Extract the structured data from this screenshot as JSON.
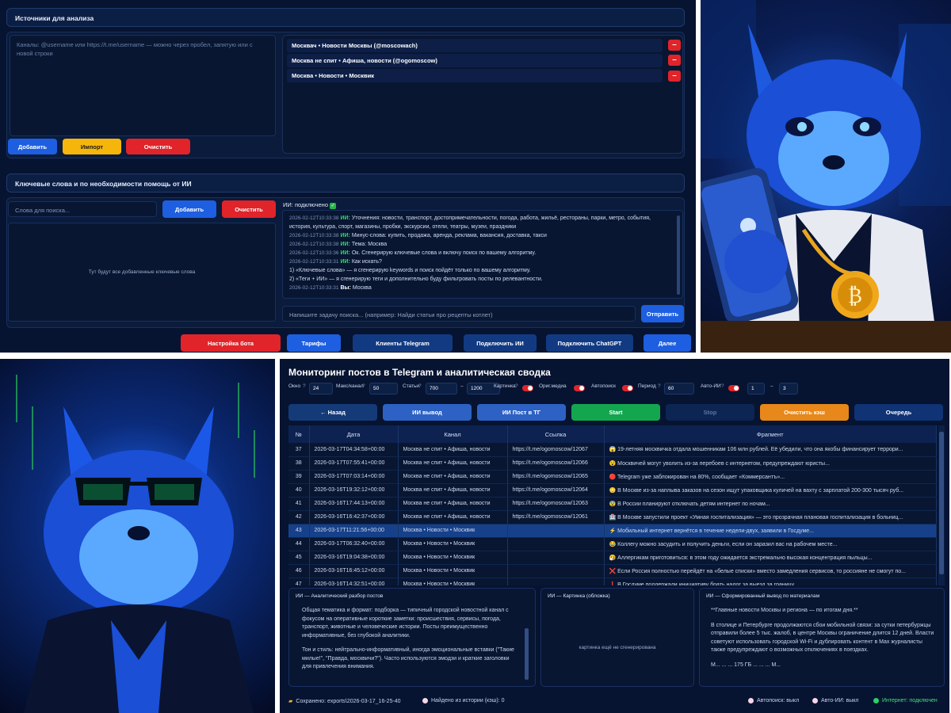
{
  "top": {
    "sources_title": "Источники для анализа",
    "sources_placeholder": "Каналы: @username или https://t.me/username — можно через пробел, запятую или с новой строки",
    "channels": [
      "Москвач • Новости Москвы  (@moscowach)",
      "Москва не спит • Афиша, новости  (@ogomoscow)",
      "Москва • Новости • Москвик"
    ],
    "remove_label": "–",
    "add_label": "Добавить",
    "import_label": "Импорт",
    "clear_label": "Очистить",
    "keywords_title": "Ключевые слова и по необходимости помощь от ИИ",
    "search_placeholder": "Слова для поиска...",
    "kw_add_label": "Добавить",
    "kw_clear_label": "Очистить",
    "ai_status": "ИИ: подключено",
    "kw_empty": "Тут будут все добавленные ключевые слова",
    "chat_log": [
      {
        "ts": "2026-02-12T10:33:38",
        "who": "ИИ:",
        "text": "Уточнения: новости, транспорт, достопримечательности, погода, работа, жильё, рестораны, парки, метро, события,"
      },
      {
        "ts": "",
        "who": "",
        "text": "история, культура, спорт, магазины, пробки, экскурсии, отели, театры, музеи, праздники"
      },
      {
        "ts": "2026-02-12T10:33:38",
        "who": "ИИ:",
        "text": "Минус-слова: купить, продажа, аренда, реклама, вакансия, доставка, такси"
      },
      {
        "ts": "2026-02-12T10:33:38",
        "who": "ИИ:",
        "text": "Тема: Москва"
      },
      {
        "ts": "2026-02-12T10:33:36",
        "who": "ИИ:",
        "text": "Ок. Сгенерирую ключевые слова и включу поиск по вашему алгоритму."
      },
      {
        "ts": "2026-02-12T10:33:31",
        "who": "ИИ:",
        "text": "Как искать?"
      },
      {
        "ts": "",
        "who": "",
        "text": "1) «Ключевые слова» — я сгенерирую keywords и поиск пойдёт только по вашему алгоритму."
      },
      {
        "ts": "",
        "who": "",
        "text": "2) «Теги + ИИ» — я сгенерирую теги и дополнительно буду фильтровать посты по релевантности."
      },
      {
        "ts": "2026-02-12T10:33:31",
        "who": "Вы:",
        "text": "Москва"
      }
    ],
    "task_placeholder": "Напишите задачу поиска... (например: Найди статьи про рецепты котлет)",
    "send_label": "Отправить",
    "nav": [
      "Настройка бота",
      "Тарифы",
      "Клиенты Telegram",
      "Подключить ИИ",
      "Подключить ChatGPT",
      "Далее"
    ]
  },
  "monitor": {
    "title": "Мониторинг постов в Telegram и аналитическая сводка",
    "controls": {
      "window_label": "Окно",
      "window_val": "24",
      "max_label": "Макс/канал",
      "max_val": "50",
      "articles_label": "Статьи",
      "art_min": "700",
      "art_max": "1200",
      "picture_label": "Картинка",
      "media_label": "Ориг.медиа",
      "autosearch_label": "Автопоиск",
      "period_label": "Период",
      "period_val": "60",
      "autoai_label": "Авто-ИИ",
      "ai_min": "1",
      "ai_max": "3",
      "help": "?",
      "dash": "–"
    },
    "buttons": [
      "← Назад",
      "ИИ вывод",
      "ИИ Пост в ТГ",
      "Start",
      "Stop",
      "Очистить кэш",
      "Очередь"
    ],
    "columns": [
      "№",
      "Дата",
      "Канал",
      "Ссылка",
      "Фрагмент"
    ],
    "rows": [
      [
        "37",
        "2026-03-17T04:34:58+00:00",
        "Москва не спит • Афиша, новости",
        "https://t.me/ogomoscow/12067",
        "😱 19-летняя москвичка отдала мошенникам 106 млн рублей. Её убедили, что она якобы финансирует террори..."
      ],
      [
        "38",
        "2026-03-17T07:55:41+00:00",
        "Москва не спит • Афиша, новости",
        "https://t.me/ogomoscow/12066",
        "😵 Москвичей могут уволить из-за перебоев с интернетом, предупреждают юристы..."
      ],
      [
        "39",
        "2026-03-17T07:03:14+00:00",
        "Москва не спит • Афиша, новости",
        "https://t.me/ogomoscow/12065",
        "🔴 Telegram уже заблокирован на 80%, сообщает «Коммерсантъ»..."
      ],
      [
        "40",
        "2026-03-16T19:32:12+00:00",
        "Москва не спит • Афиша, новости",
        "https://t.me/ogomoscow/12064",
        "😳 В Москве из-за наплыва заказов на сезон ищут упаковщика куличей на вахту с зарплатой 200-300 тысяч руб..."
      ],
      [
        "41",
        "2026-03-16T17:44:13+00:00",
        "Москва не спит • Афиша, новости",
        "https://t.me/ogomoscow/12063",
        "😨 В России планируют отключать детям интернет по ночам..."
      ],
      [
        "42",
        "2026-03-16T16:42:37+00:00",
        "Москва не спит • Афиша, новости",
        "https://t.me/ogomoscow/12061",
        "🏥 В Москве запустили проект «Умная госпитализация» — это прозрачная плановая госпитализация в больниц..."
      ],
      [
        "43",
        "2026-03-17T11:21:56+00:00",
        "Москва • Новости • Москвик",
        "",
        "⚡ Мобильный интернет вернётся в течение недели-двух, заявили в Госдуме..."
      ],
      [
        "44",
        "2026-03-17T06:32:40+00:00",
        "Москва • Новости • Москвик",
        "",
        "😂 Коллегу можно засудить и получить деньги, если он заразил вас на рабочем месте..."
      ],
      [
        "45",
        "2026-03-16T19:04:38+00:00",
        "Москва • Новости • Москвик",
        "",
        "🤧 Аллергикам приготовиться: в этом году ожидается экстремально высокая концентрация пыльцы..."
      ],
      [
        "46",
        "2026-03-16T16:45:12+00:00",
        "Москва • Новости • Москвик",
        "",
        "❌ Если Россия полностью перейдёт на «белые списки» вместо замедления сервисов, то россияне не смогут по..."
      ],
      [
        "47",
        "2026-03-16T14:32:51+00:00",
        "Москва • Новости • Москвик",
        "",
        "❗ В Госдуме поддержали инициативу брать налог за выезд за границу, ..."
      ]
    ],
    "box1_title": "ИИ — Аналитический разбор постов",
    "box1_text1": "Общая тематика и формат: подборка — типичный городской новостной канал с фокусом на оперативные короткие заметки: происшествия, сервисы, погода, транспорт, животные и человеческие истории. Посты преимущественно информативные, без глубокой аналитики.",
    "box1_text2": "Тон и стиль: нейтрально-информативный, иногда эмоциональные вставки (\"Такие милые!\", \"Правда, москвичи?\"). Часто используются эмодзи и краткие заголовки для привлечения внимания.",
    "box2_title": "ИИ — Картинка (обложка)",
    "box2_text": "картинка ещё не сгенерирована",
    "box3_title": "ИИ — Сформированный вывод по материалам",
    "box3_text1": "**Главные новости Москвы и региона — по итогам дня.**",
    "box3_text2": "В столице и Петербурге продолжаются сбои мобильной связи: за сутки петербуржцы отправили более 5 тыс. жалоб, в центре Москвы ограничение длится 12 дней. Власти советуют использовать городской Wi-Fi и дублировать контент в Max журналисты также предупреждают о возможных отключениях в поездках.",
    "box3_text3": "М... ... ... 175 ГБ ... ... ... М...",
    "status_saved": "Сохранено: exports\\2026-03-17_16-25-40",
    "status_found": "Найдено из истории (кэш): 0",
    "status_auto": "Автопоиск: выкл",
    "status_autoai": "Авто-ИИ: выкл",
    "status_net": "Интернет: подключен"
  },
  "colors": {
    "bg": "#061431",
    "accent_blue": "#1d5fe0",
    "red": "#e0242a",
    "green": "#13a64f",
    "yellow": "#f5b50b"
  }
}
